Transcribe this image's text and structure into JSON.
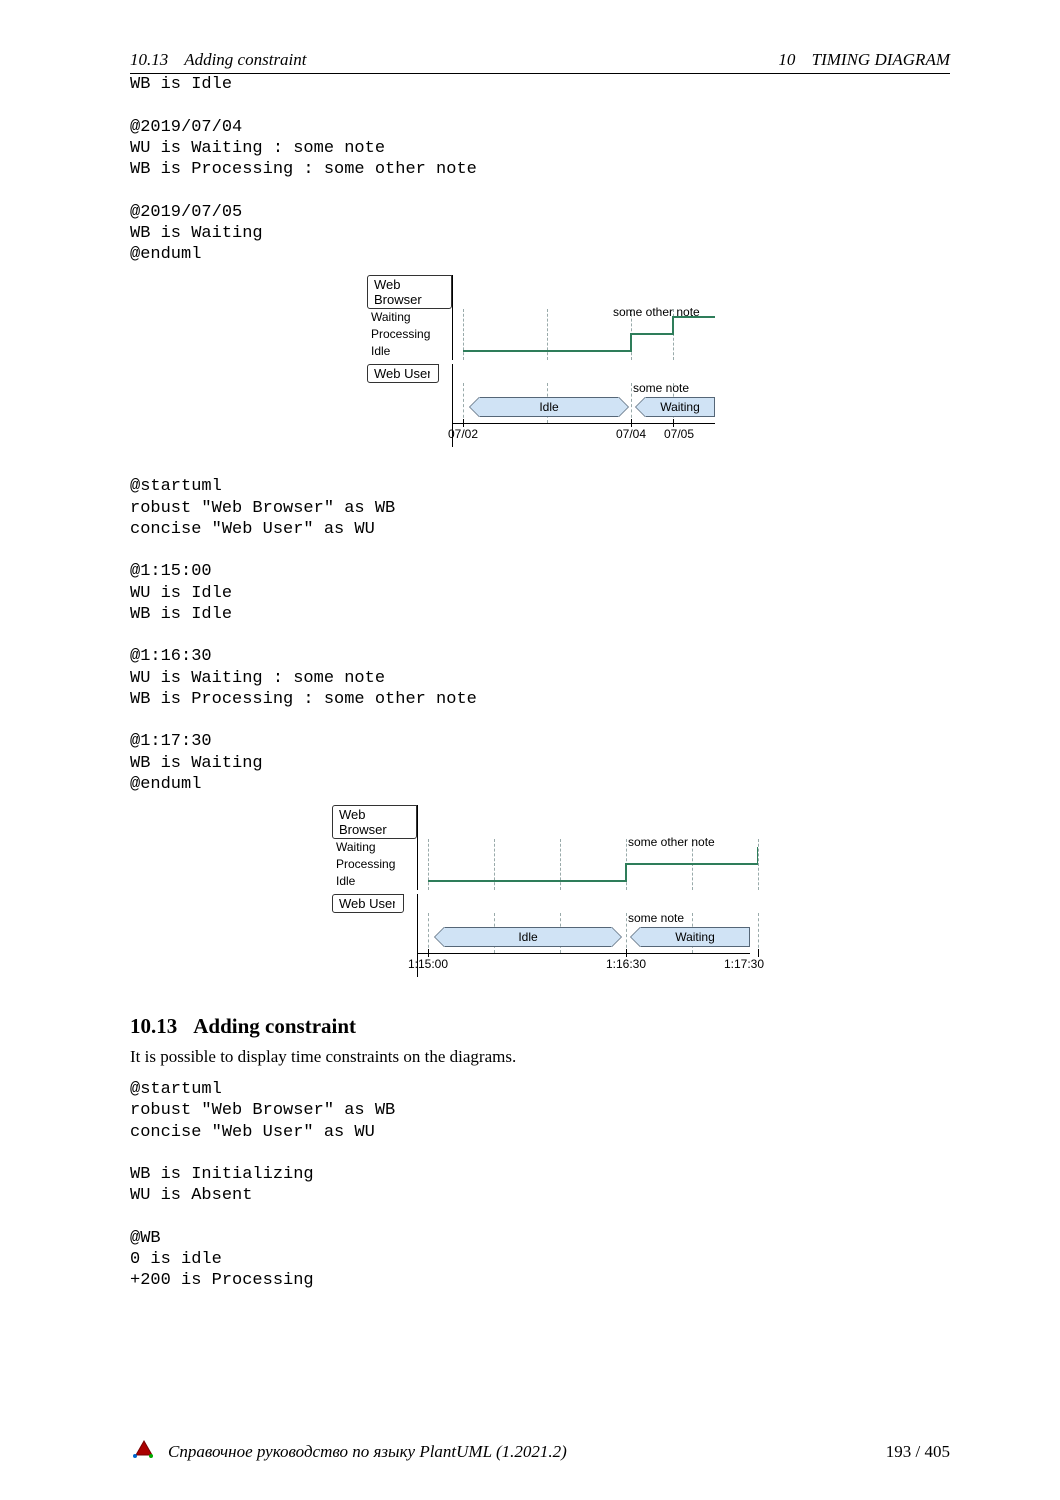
{
  "header": {
    "left_section_no": "10.13",
    "left_section_title": "Adding constraint",
    "right_section_no": "10",
    "right_section_title": "TIMING DIAGRAM"
  },
  "code_block_1": "WB is Idle\n\n@2019/07/04\nWU is Waiting : some note\nWB is Processing : some other note\n\n@2019/07/05\nWB is Waiting\n@enduml",
  "diagram1": {
    "web_browser_label": "Web Browser",
    "web_user_label": "Web User",
    "states": {
      "waiting": "Waiting",
      "processing": "Processing",
      "idle": "Idle"
    },
    "note_wb": "some other note",
    "note_wu": "some note",
    "seg_idle": "Idle",
    "seg_waiting": "Waiting",
    "ticks": {
      "t1": "07/02",
      "t2": "07/04",
      "t3": "07/05"
    }
  },
  "code_block_2": "@startuml\nrobust \"Web Browser\" as WB\nconcise \"Web User\" as WU\n\n@1:15:00\nWU is Idle\nWB is Idle\n\n@1:16:30\nWU is Waiting : some note\nWB is Processing : some other note\n\n@1:17:30\nWB is Waiting\n@enduml",
  "diagram2": {
    "web_browser_label": "Web Browser",
    "web_user_label": "Web User",
    "states": {
      "waiting": "Waiting",
      "processing": "Processing",
      "idle": "Idle"
    },
    "note_wb": "some other note",
    "note_wu": "some note",
    "seg_idle": "Idle",
    "seg_waiting": "Waiting",
    "ticks": {
      "t1": "1:15:00",
      "t2": "1:16:30",
      "t3": "1:17:30"
    }
  },
  "section": {
    "number": "10.13",
    "title": "Adding constraint",
    "intro": "It is possible to display time constraints on the diagrams."
  },
  "code_block_3": "@startuml\nrobust \"Web Browser\" as WB\nconcise \"Web User\" as WU\n\nWB is Initializing\nWU is Absent\n\n@WB\n0 is idle\n+200 is Processing",
  "footer": {
    "text": "Справочное руководство по языку PlantUML (1.2021.2)",
    "page": "193 / 405"
  }
}
